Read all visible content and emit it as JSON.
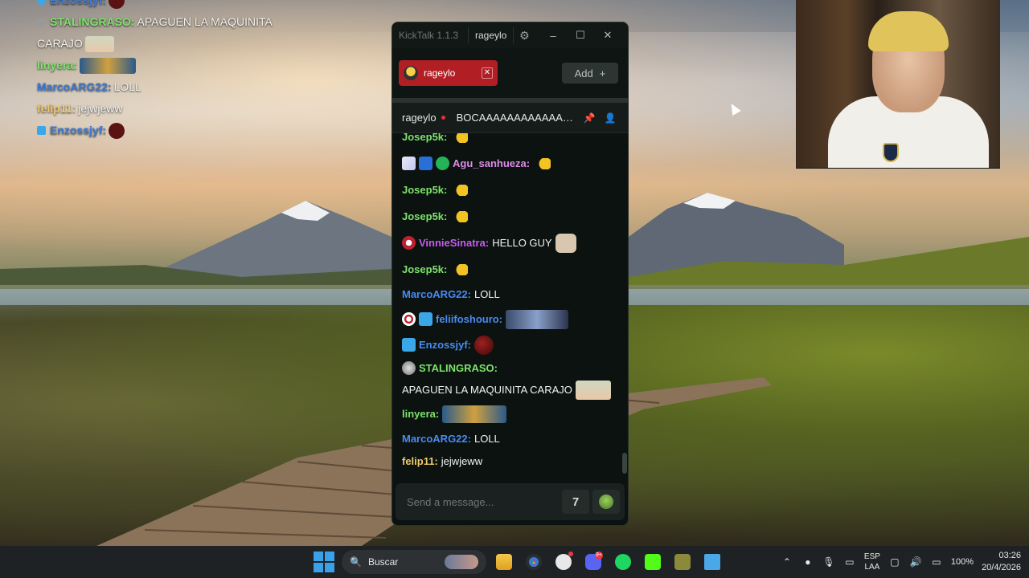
{
  "desktop": {
    "overlay_lines": [
      {
        "user": "Enzossjyf:",
        "text": "",
        "color": "#3b7bd8"
      },
      {
        "user": "STALINGRASO:",
        "text": "APAGUEN LA MAQUINITA",
        "color": "#7de36a"
      },
      {
        "user": "",
        "text": "CARAJO",
        "color": "#ffffff"
      },
      {
        "user": "linyera:",
        "text": "",
        "color": "#7de36a"
      },
      {
        "user": "MarcoARG22:",
        "text": "LOLL",
        "color": "#3b7bd8"
      },
      {
        "user": "felip11:",
        "text": "jejwjeww",
        "color": "#f0c86a"
      },
      {
        "user": "Enzossjyf:",
        "text": "",
        "color": "#3b7bd8"
      }
    ]
  },
  "app": {
    "title": "KickTalk 1.1.3",
    "channel": "rageylo",
    "settings_icon": "gear-icon",
    "window_controls": {
      "minimize": "–",
      "maximize": "☐",
      "close": "✕"
    }
  },
  "tabs": {
    "active": {
      "label": "rageylo",
      "close": "✕"
    },
    "add_label": "Add",
    "add_icon": "+"
  },
  "chat_header": {
    "channel": "rageylo",
    "stream_title": "BOCAAAAAAAAAAAAAAA",
    "icons": [
      "pin-icon",
      "user-icon"
    ]
  },
  "messages": [
    {
      "user": "Josep5k:",
      "color": "#7de36a",
      "text": "",
      "emote": "hand-emote"
    },
    {
      "user": "Agu_sanhueza:",
      "color": "#e08be8",
      "text": "",
      "emote": "hand-emote",
      "badges": [
        "tile-badge",
        "hammer-badge",
        "verified-badge"
      ]
    },
    {
      "user": "Josep5k:",
      "color": "#7de36a",
      "text": "",
      "emote": "hand-emote"
    },
    {
      "user": "Josep5k:",
      "color": "#7de36a",
      "text": "",
      "emote": "hand-emote"
    },
    {
      "user": "VinnieSinatra:",
      "color": "#c65cf0",
      "text": "HELLO GUY",
      "emote": "cat-emote",
      "badges": [
        "mouth-badge"
      ]
    },
    {
      "user": "Josep5k:",
      "color": "#7de36a",
      "text": "",
      "emote": "hand-emote"
    },
    {
      "user": "MarcoARG22:",
      "color": "#4a8bf0",
      "text": "LOLL",
      "emote": ""
    },
    {
      "user": "feliifoshouro:",
      "color": "#4a8bf0",
      "text": "",
      "emote": "wide-emote",
      "badges": [
        "target-badge",
        "cube-badge"
      ]
    },
    {
      "user": "Enzossjyf:",
      "color": "#4a8bf0",
      "text": "",
      "emote": "red-ball-emote",
      "badges": [
        "cube-badge"
      ]
    },
    {
      "user": "STALINGRASO:",
      "color": "#7de36a",
      "text": "APAGUEN LA MAQUINITA CARAJO",
      "emote": "face-emote",
      "badges": [
        "orb-badge"
      ]
    },
    {
      "user": "linyera:",
      "color": "#7de36a",
      "text": "",
      "emote": "cups-emote"
    },
    {
      "user": "MarcoARG22:",
      "color": "#4a8bf0",
      "text": "LOLL",
      "emote": ""
    },
    {
      "user": "felip11:",
      "color": "#f0c86a",
      "text": "jejwjeww",
      "emote": ""
    }
  ],
  "input": {
    "placeholder": "Send a message...",
    "kick_label": "7",
    "emote_icon": "emote-picker-icon"
  },
  "taskbar": {
    "search_label": "Buscar",
    "apps": [
      "file-explorer-icon",
      "chrome-icon",
      "obs-icon",
      "discord-icon",
      "spotify-icon",
      "kick-icon",
      "app-icon",
      "notepad-icon"
    ],
    "discord_notif": "9+",
    "lang_top": "ESP",
    "lang_bottom": "LAA",
    "battery": "100%",
    "time": "03:26",
    "date": "20/4/2026"
  },
  "colors": {
    "accent": "#b11f24",
    "kick_green": "#53fc18"
  }
}
